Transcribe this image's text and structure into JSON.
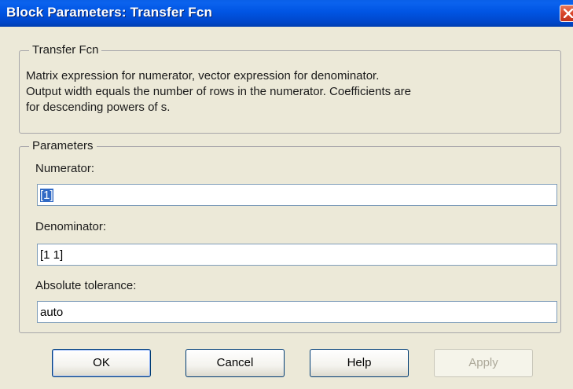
{
  "window": {
    "title": "Block Parameters: Transfer Fcn"
  },
  "description_group": {
    "legend": "Transfer Fcn",
    "lines": [
      "Matrix expression for numerator, vector expression for denominator.",
      "Output width equals the number of rows in the numerator.  Coefficients are",
      "for descending powers of s."
    ]
  },
  "parameters_group": {
    "legend": "Parameters",
    "numerator": {
      "label": "Numerator:",
      "value": "[1]"
    },
    "denominator": {
      "label": "Denominator:",
      "value": "[1 1]"
    },
    "absolute_tolerance": {
      "label": "Absolute tolerance:",
      "value": "auto"
    }
  },
  "buttons": {
    "ok": "OK",
    "cancel": "Cancel",
    "help": "Help",
    "apply": "Apply",
    "apply_enabled": false
  },
  "colors": {
    "titlebar": "#0054e3",
    "dialog_bg": "#ece9d8",
    "selection": "#316ac5",
    "close_button": "#d8452a"
  },
  "icons": {
    "close": "close-icon"
  }
}
